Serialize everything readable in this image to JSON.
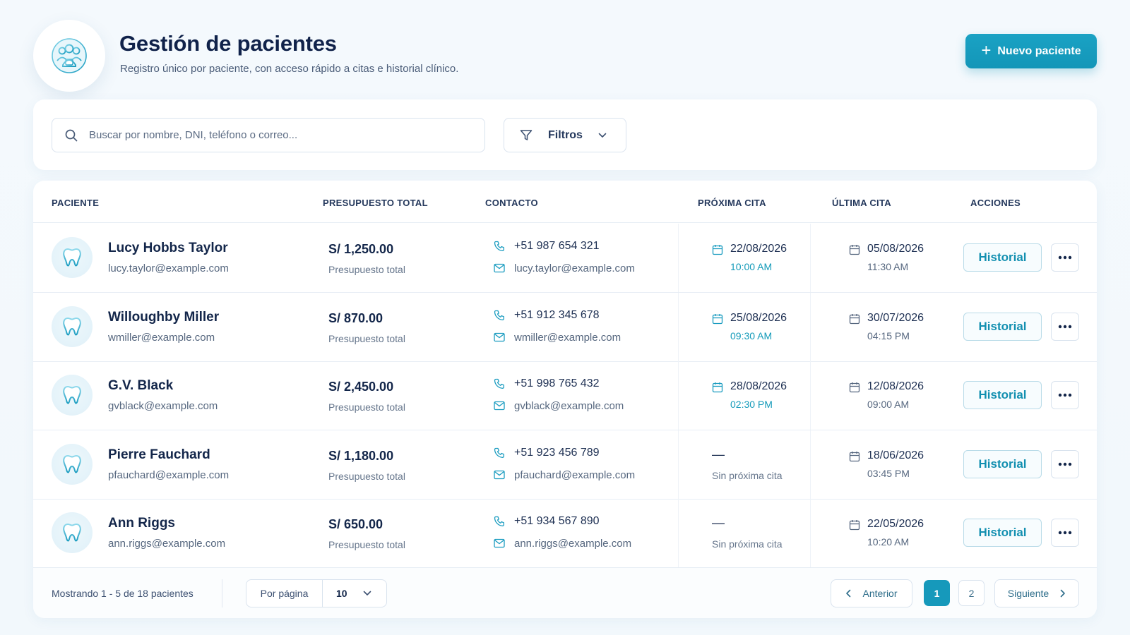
{
  "header": {
    "title": "Gestión de pacientes",
    "subtitle": "Registro único por paciente, con acceso rápido a citas e historial clínico.",
    "logo_icon": "patients-group-icon",
    "new_patient_label": "Nuevo paciente"
  },
  "search": {
    "placeholder": "Buscar por nombre, DNI, teléfono o correo...",
    "filters_label": "Filtros"
  },
  "table": {
    "columns": [
      "PACIENTE",
      "PRESUPUESTO TOTAL",
      "CONTACTO",
      "PRÓXIMA CITA",
      "ÚLTIMA CITA",
      "ACCIONES"
    ],
    "rows": [
      {
        "name": "Lucy Hobbs Taylor",
        "email": "lucy.taylor@example.com",
        "budget": "S/ 1,250.00",
        "budget_label": "Presupuesto total",
        "phone": "+51 987 654 321",
        "next_date": "22/08/2026",
        "next_time": "10:00 AM",
        "last_date": "05/08/2026",
        "last_time": "11:30 AM",
        "history_label": "Historial"
      },
      {
        "name": "Willoughby Miller",
        "email": "wmiller@example.com",
        "budget": "S/ 870.00",
        "budget_label": "Presupuesto total",
        "phone": "+51 912 345 678",
        "next_date": "25/08/2026",
        "next_time": "09:30 AM",
        "last_date": "30/07/2026",
        "last_time": "04:15 PM",
        "history_label": "Historial"
      },
      {
        "name": "G.V. Black",
        "email": "gvblack@example.com",
        "budget": "S/ 2,450.00",
        "budget_label": "Presupuesto total",
        "phone": "+51 998 765 432",
        "next_date": "28/08/2026",
        "next_time": "02:30 PM",
        "last_date": "12/08/2026",
        "last_time": "09:00 AM",
        "history_label": "Historial"
      },
      {
        "name": "Pierre Fauchard",
        "email": "pfauchard@example.com",
        "budget": "S/ 1,180.00",
        "budget_label": "Presupuesto total",
        "phone": "+51 923 456 789",
        "next_dash": "—",
        "next_none": "Sin próxima cita",
        "last_date": "18/06/2026",
        "last_time": "03:45 PM",
        "history_label": "Historial"
      },
      {
        "name": "Ann Riggs",
        "email": "ann.riggs@example.com",
        "budget": "S/ 650.00",
        "budget_label": "Presupuesto total",
        "phone": "+51 934 567 890",
        "next_dash": "—",
        "next_none": "Sin próxima cita",
        "last_date": "22/05/2026",
        "last_time": "10:20 AM",
        "history_label": "Historial"
      }
    ]
  },
  "footer": {
    "showing": "Mostrando 1 - 5 de 18 pacientes",
    "per_page_label": "Por página",
    "per_page_value": "10",
    "prev_label": "Anterior",
    "pages": [
      "1",
      "2"
    ],
    "current_page": "1",
    "next_label": "Siguiente"
  },
  "colors": {
    "accent": "#1699bb",
    "title": "#10224a",
    "background": "#f4f9fd"
  }
}
